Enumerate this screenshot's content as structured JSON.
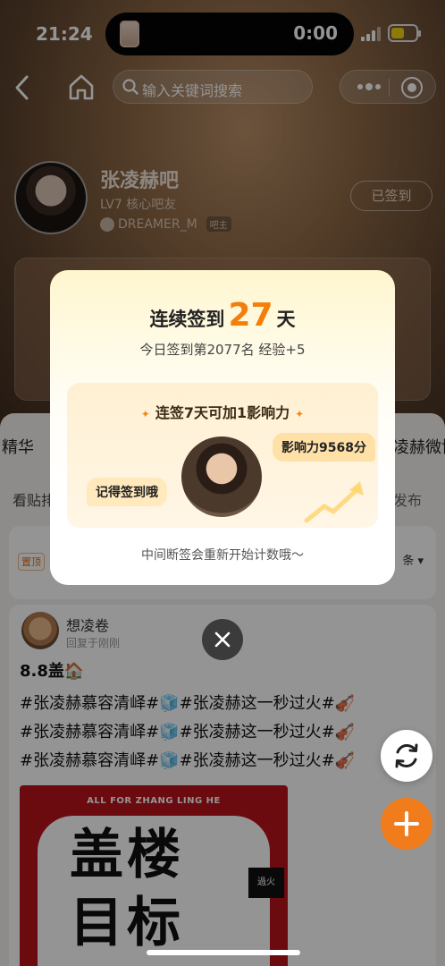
{
  "status": {
    "time": "21:24",
    "timer": "0:00"
  },
  "nav": {
    "search_placeholder": "输入关键词搜索"
  },
  "forum": {
    "name": "张凌赫吧",
    "level": "LV7 核心吧友",
    "owner_name": "DREAMER_M",
    "owner_tag": "吧主",
    "signed_label": "已签到"
  },
  "tabs": {
    "left": "精华",
    "right": "凌赫微博"
  },
  "sort": {
    "left": "看贴排",
    "publish": "发布"
  },
  "pinned": {
    "tag": "置顶",
    "more": "条"
  },
  "post": {
    "author": "想凌卷",
    "time": "回复于刚刚",
    "title": "8.8盖🏠",
    "lines": [
      "#张凌赫慕容清峄#🧊#张凌赫这一秒过火#🎻",
      "#张凌赫慕容清峄#🧊#张凌赫这一秒过火#🎻",
      "#张凌赫慕容清峄#🧊#张凌赫这一秒过火#🎻"
    ],
    "image_caption": "ALL FOR ZHANG LING HE",
    "image_text_1": "盖楼",
    "image_text_2": "目标",
    "image_stamp": "過火"
  },
  "popup": {
    "title_prefix": "连续签到",
    "streak_days": "27",
    "title_suffix": "天",
    "subtitle": "今日签到第2077名 经验+5",
    "reward_title": "连签7天可加1影响力",
    "bubble_left": "记得签到哦",
    "bubble_right": "影响力9568分",
    "footer": "中间断签会重新开始计数哦～"
  },
  "colors": {
    "accent": "#f57d0a",
    "fab": "#f07c1c"
  }
}
